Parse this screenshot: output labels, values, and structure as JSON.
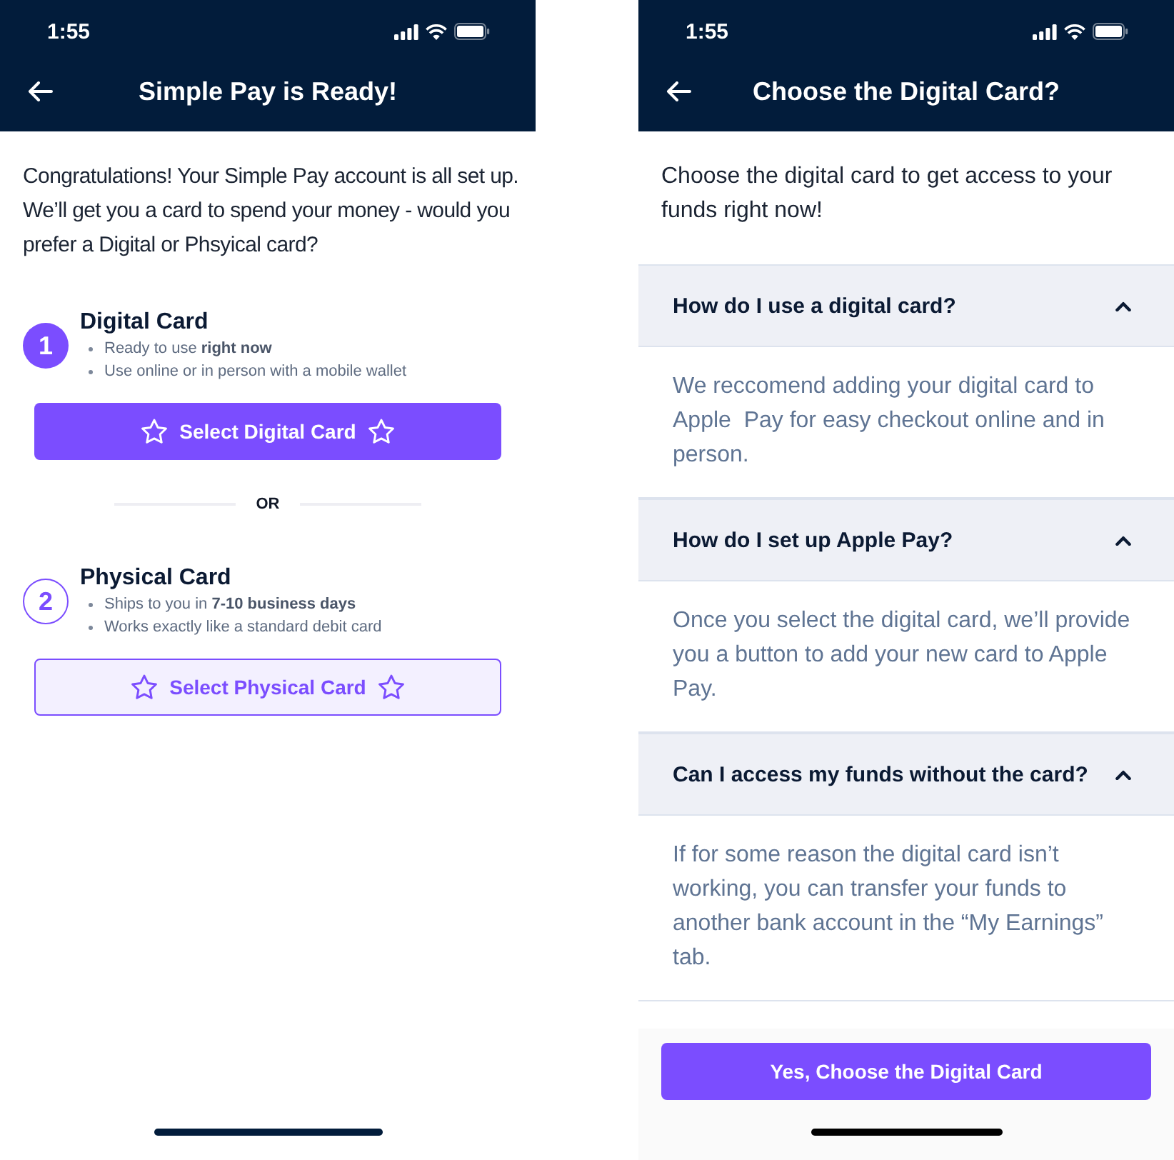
{
  "screens": [
    {
      "status_bar": {
        "time": "1:55"
      },
      "header": {
        "title": "Simple Pay is Ready!"
      },
      "intro": "Congratulations! Your Simple Pay account is all set up. We’ll get you a card to spend your money - would you prefer a Digital or Phsyical card?",
      "options": [
        {
          "kind": "primary",
          "number": "1",
          "title": "Digital Card",
          "bullets": [
            "Ready to use **right now**",
            "Use online or in person with a mobile wallet"
          ],
          "button": "Select Digital Card"
        },
        {
          "kind": "secondary",
          "number": "2",
          "title": "Physical Card",
          "bullets": [
            "Ships to you in **7-10 business days**",
            "Works exactly like a standard debit card"
          ],
          "button": "Select Physical Card"
        }
      ],
      "divider": "OR"
    },
    {
      "status_bar": {
        "time": "1:55"
      },
      "header": {
        "title": "Choose the Digital Card?"
      },
      "intro": "Choose the digital card to get access to your funds right now!",
      "faqs": [
        {
          "question": "How do I use a digital card?",
          "expanded": true,
          "answer": "We reccomend adding your digital card to Apple  Pay for easy checkout online and in person."
        },
        {
          "question": "How do I set up Apple Pay?",
          "expanded": true,
          "answer": "Once you select the digital card, we’ll provide you a button to add your new card to Apple Pay."
        },
        {
          "question": "Can I access my funds without the card?",
          "expanded": true,
          "answer": "If for some reason the digital card isn’t working, you can transfer your funds to another bank account in the “My Earnings” tab."
        }
      ],
      "footer_button": "Yes, Choose the Digital Card"
    }
  ]
}
